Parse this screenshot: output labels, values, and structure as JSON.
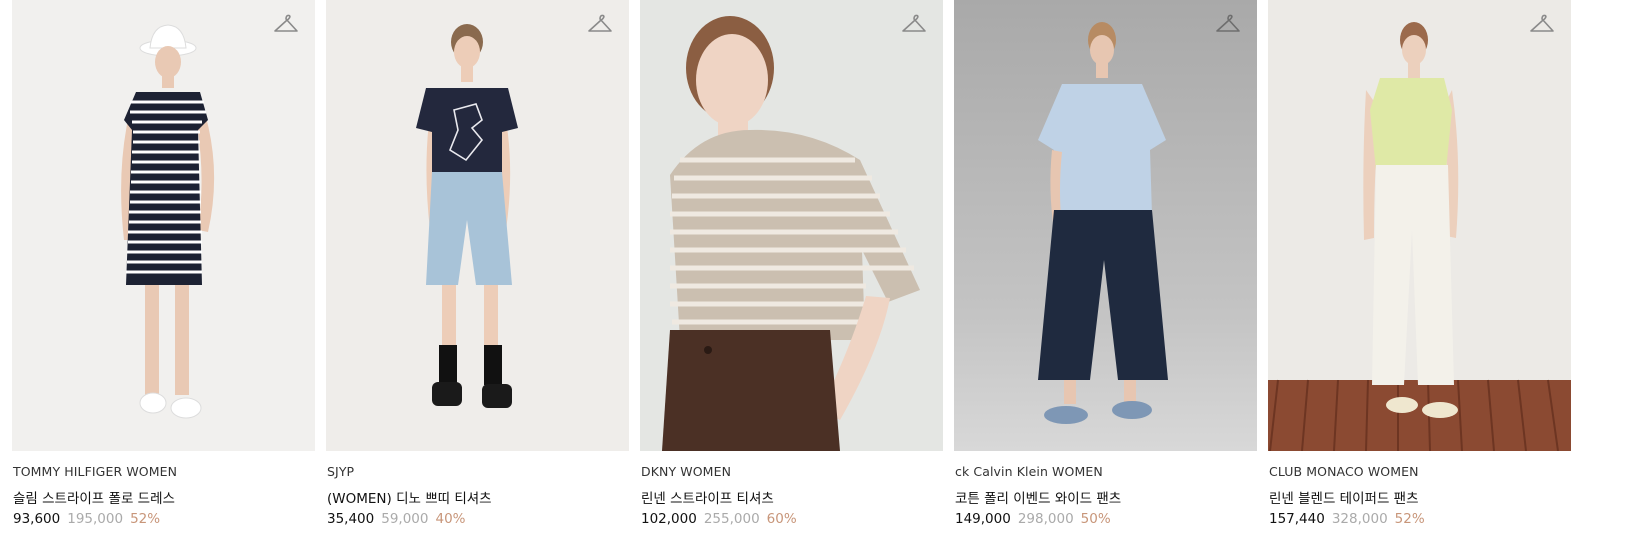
{
  "colors": {
    "discount": "#c8967a",
    "original_price": "#aaaaaa",
    "text": "#111111"
  },
  "products": [
    {
      "brand": "TOMMY HILFIGER WOMEN",
      "name": "슬림 스트라이프 폴로 드레스",
      "price": "93,600",
      "original_price": "195,000",
      "discount": "52%",
      "icon": "hanger-icon",
      "bg": "#f1f0ee"
    },
    {
      "brand": "SJYP",
      "name": "(WOMEN) 디노 쁘띠 티셔츠",
      "price": "35,400",
      "original_price": "59,000",
      "discount": "40%",
      "icon": "hanger-icon",
      "bg": "#efedea"
    },
    {
      "brand": "DKNY WOMEN",
      "name": "린넨 스트라이프 티셔츠",
      "price": "102,000",
      "original_price": "255,000",
      "discount": "60%",
      "icon": "hanger-icon",
      "bg": "#e4e6e3"
    },
    {
      "brand": "ck Calvin Klein WOMEN",
      "name": "코튼 폴리 이벤드 와이드 팬츠",
      "price": "149,000",
      "original_price": "298,000",
      "discount": "50%",
      "icon": "hanger-icon",
      "bg": "#bdbdbd"
    },
    {
      "brand": "CLUB MONACO WOMEN",
      "name": "린넨 블렌드 테이퍼드 팬츠",
      "price": "157,440",
      "original_price": "328,000",
      "discount": "52%",
      "icon": "hanger-icon",
      "bg": "#eceae6"
    }
  ]
}
